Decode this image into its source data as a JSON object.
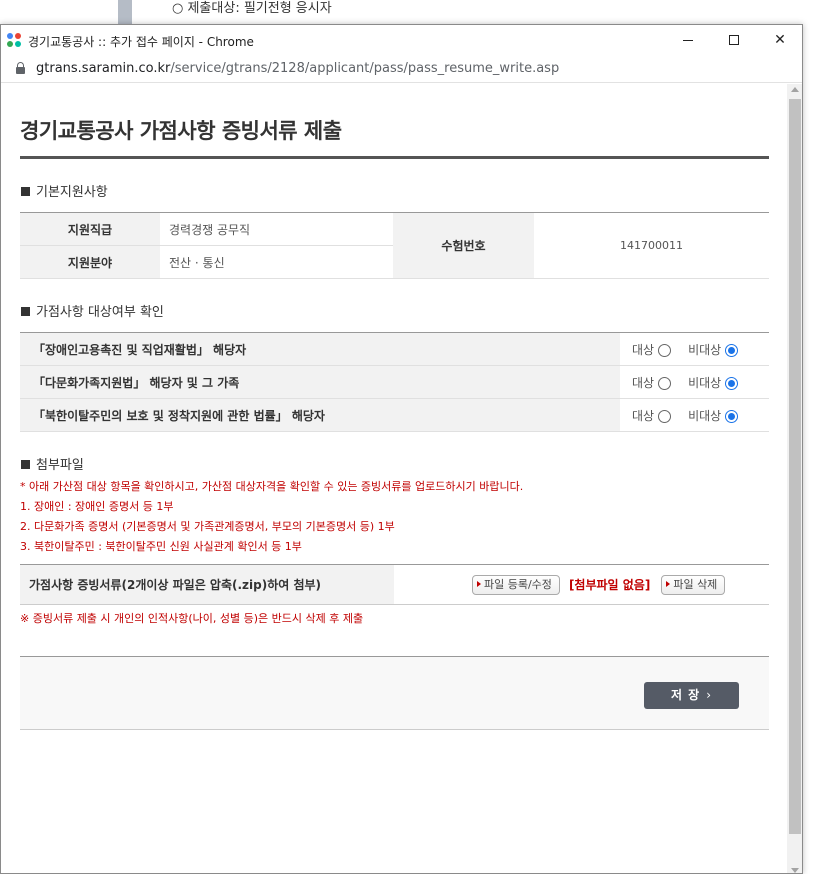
{
  "background": {
    "text": "○ 제출대상: 필기전형 응시자"
  },
  "window": {
    "title": "경기교통공사 :: 추가 접수 페이지 - Chrome",
    "url_host": "gtrans.saramin.co.kr",
    "url_path": "/service/gtrans/2128/applicant/pass/pass_resume_write.asp",
    "close_symbol": "✕"
  },
  "page": {
    "title": "경기교통공사 가점사항 증빙서류 제출"
  },
  "basic_info": {
    "section_title": "기본지원사항",
    "rows": [
      {
        "label": "지원직급",
        "value": "경력경쟁 공무직"
      },
      {
        "label": "지원분야",
        "value": "전산 · 통신"
      }
    ],
    "exam_no_label": "수험번호",
    "exam_no_value": "141700011"
  },
  "bonus_target": {
    "section_title": "가점사항 대상여부 확인",
    "option_yes": "대상",
    "option_no": "비대상",
    "rows": [
      {
        "label": "「장애인고용촉진 및 직업재활법」 해당자",
        "selected": "비대상"
      },
      {
        "label": "「다문화가족지원법」 해당자 및 그 가족",
        "selected": "비대상"
      },
      {
        "label": "「북한이탈주민의 보호 및 정착지원에 관한 법률」 해당자",
        "selected": "비대상"
      }
    ]
  },
  "attachment": {
    "section_title": "첨부파일",
    "notice_lines": [
      "* 아래 가산점 대상 항목을 확인하시고, 가산점 대상자격을 확인할 수 있는 증빙서류를 업로드하시기 바랍니다.",
      "1. 장애인 : 장애인 증명서 등 1부",
      "2. 다문화가족 증명서 (기본증명서 및 가족관계증명서, 부모의 기본증명서 등) 1부",
      "3. 북한이탈주민 : 북한이탈주민 신원 사실관계 확인서 등 1부"
    ],
    "file_label": "가점사항 증빙서류(2개이상 파일은 압축(.zip)하여 첨부)",
    "register_button": "파일 등록/수정",
    "no_file_text": "[첨부파일 없음]",
    "delete_button": "파일 삭제",
    "bottom_notice": "※ 증빙서류 제출 시 개인의 인적사항(나이, 성별 등)은 반드시 삭제 후 제출"
  },
  "actions": {
    "save_label": "저 장",
    "save_chevron": "›"
  },
  "colors": {
    "accent_red": "#c00000",
    "save_button": "#555b66",
    "radio_checked": "#1a73e8"
  }
}
